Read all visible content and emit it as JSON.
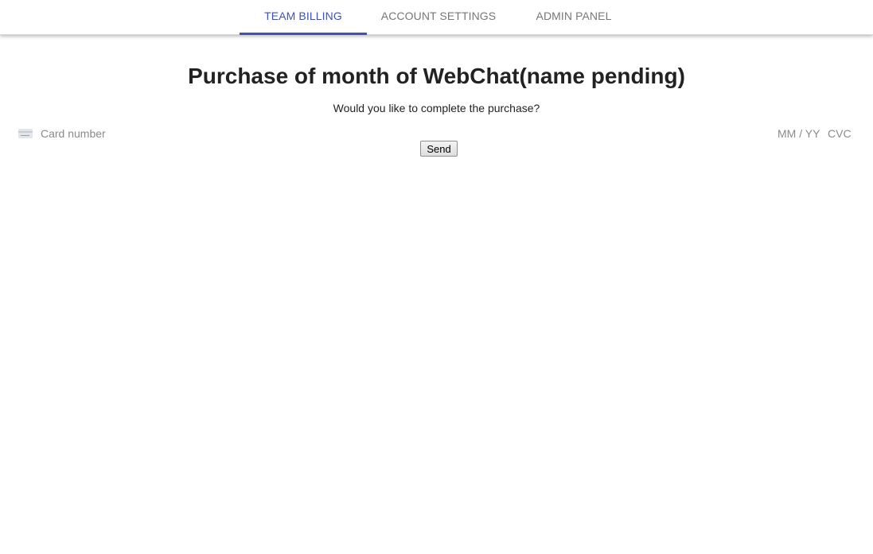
{
  "nav": {
    "tabs": [
      {
        "label": "TEAM BILLING",
        "active": true
      },
      {
        "label": "ACCOUNT SETTINGS",
        "active": false
      },
      {
        "label": "ADMIN PANEL",
        "active": false
      }
    ]
  },
  "main": {
    "title": "Purchase of month of WebChat(name pending)",
    "question": "Would you like to complete the purchase?"
  },
  "payment": {
    "card_icon": "credit-card-icon",
    "card_number_placeholder": "Card number",
    "expiry_placeholder": "MM / YY",
    "cvc_placeholder": "CVC",
    "send_label": "Send"
  },
  "colors": {
    "accent": "#3f51b5",
    "inactive_tab": "#777777"
  }
}
